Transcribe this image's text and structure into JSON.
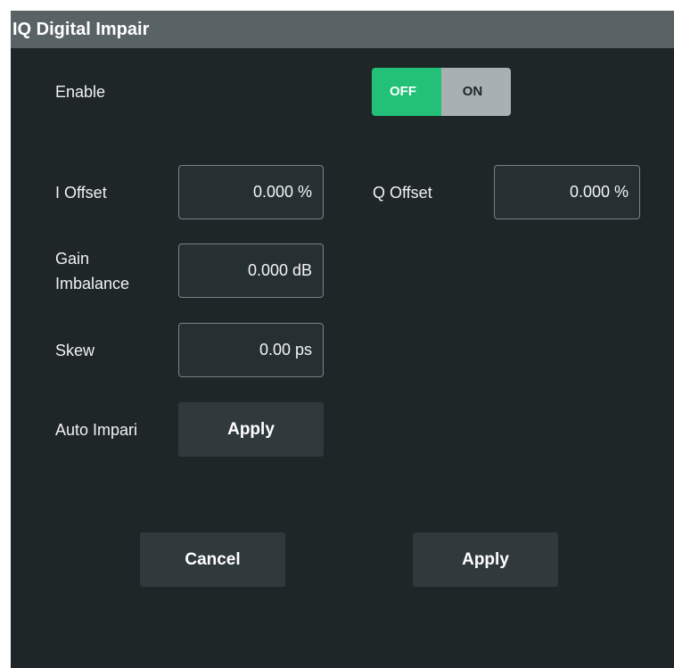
{
  "dialog": {
    "title": "IQ Digital Impair"
  },
  "enable": {
    "label": "Enable",
    "off_label": "OFF",
    "on_label": "ON",
    "selected": "OFF"
  },
  "i_offset": {
    "label": "I Offset",
    "value": "0.000 %"
  },
  "q_offset": {
    "label": "Q Offset",
    "value": "0.000 %"
  },
  "gain_imbalance": {
    "label_line1": "Gain",
    "label_line2": "Imbalance",
    "value": "0.000 dB"
  },
  "skew": {
    "label": "Skew",
    "value": "0.00 ps"
  },
  "auto_impair": {
    "label": "Auto Impari",
    "button_label": "Apply"
  },
  "footer": {
    "cancel_label": "Cancel",
    "apply_label": "Apply"
  },
  "colors": {
    "background": "#1f2628",
    "titlebar": "#596365",
    "toggle_active": "#22c177",
    "toggle_inactive": "#a9b0b3"
  }
}
